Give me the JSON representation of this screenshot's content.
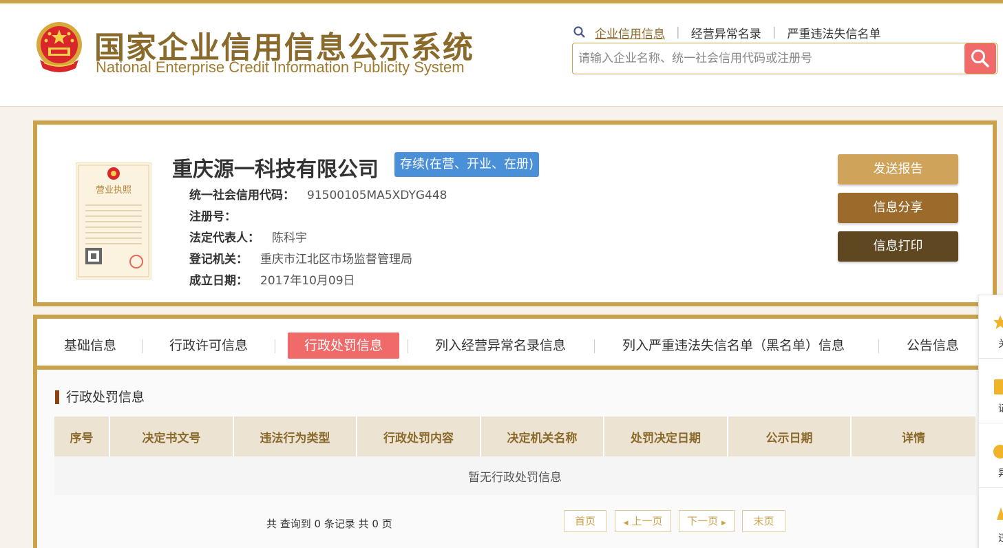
{
  "header": {
    "title_cn": "国家企业信用信息公示系统",
    "title_en": "National Enterprise Credit Information Publicity System",
    "links": [
      "企业信用信息",
      "经营异常名录",
      "严重违法失信名单"
    ],
    "search_placeholder": "请输入企业名称、统一社会信用代码或注册号"
  },
  "company": {
    "name": "重庆源一科技有限公司",
    "status": "存续(在营、开业、在册)",
    "fields": [
      {
        "label": "统一社会信用代码：",
        "value": "91500105MA5XDYG448"
      },
      {
        "label": "注册号：",
        "value": ""
      },
      {
        "label": "法定代表人：",
        "value": "陈科宇"
      },
      {
        "label": "登记机关：",
        "value": "重庆市江北区市场监督管理局"
      },
      {
        "label": "成立日期：",
        "value": "2017年10月09日"
      }
    ],
    "license_title": "营业执照"
  },
  "actions": {
    "send_report": "发送报告",
    "share": "信息分享",
    "print": "信息打印"
  },
  "tabs": [
    "基础信息",
    "行政许可信息",
    "行政处罚信息",
    "列入经营异常名录信息",
    "列入严重违法失信名单（黑名单）信息",
    "公告信息"
  ],
  "section": {
    "title": "行政处罚信息",
    "columns": [
      "序号",
      "决定书文号",
      "违法行为类型",
      "行政处罚内容",
      "决定机关名称",
      "处罚决定日期",
      "公示日期",
      "详情"
    ],
    "empty_text": "暂无行政处罚信息"
  },
  "pager": {
    "summary": "共 查询到 0 条记录 共 0 页",
    "first": "首页",
    "prev": "上一页",
    "next": "下一页",
    "last": "末页"
  },
  "side": {
    "items": [
      "关",
      "证",
      "异",
      "违"
    ]
  },
  "colors": {
    "gold": "#c9a24a",
    "accent_red": "#f06a6a",
    "status_blue": "#4a90d9",
    "btn_report": "#cfa35a",
    "btn_share": "#9c6a2a",
    "btn_print": "#5f4722"
  }
}
